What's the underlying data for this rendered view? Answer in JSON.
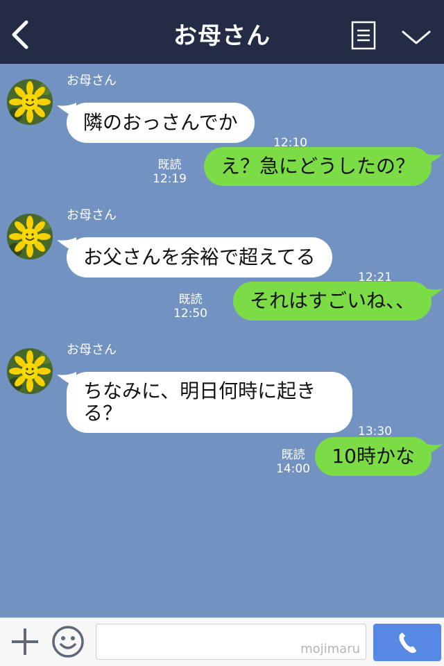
{
  "header": {
    "title": "お母さん"
  },
  "colors": {
    "background": "#7293c2",
    "header": "#232c44",
    "outgoing": "#7bdc46",
    "call_button": "#5789e4"
  },
  "messages": [
    {
      "sender": "お母さん",
      "text": "隣のおっさんでか",
      "time": "12:10"
    },
    {
      "text": "え？急にどうしたの？",
      "read": "既読",
      "time": "12:19"
    },
    {
      "sender": "お母さん",
      "text": "お父さんを余裕で超えてる",
      "time": "12:21"
    },
    {
      "text": "それはすごいね、、",
      "read": "既読",
      "time": "12:50"
    },
    {
      "sender": "お母さん",
      "text": "ちなみに、明日何時に起きる？",
      "time": "13:30"
    },
    {
      "text": "10時かな",
      "read": "既読",
      "time": "14:00"
    }
  ],
  "footer": {
    "watermark": "mojimaru"
  },
  "icons": [
    "back-chevron-icon",
    "notes-icon",
    "chevron-down-icon",
    "plus-icon",
    "emoji-icon",
    "phone-icon"
  ]
}
